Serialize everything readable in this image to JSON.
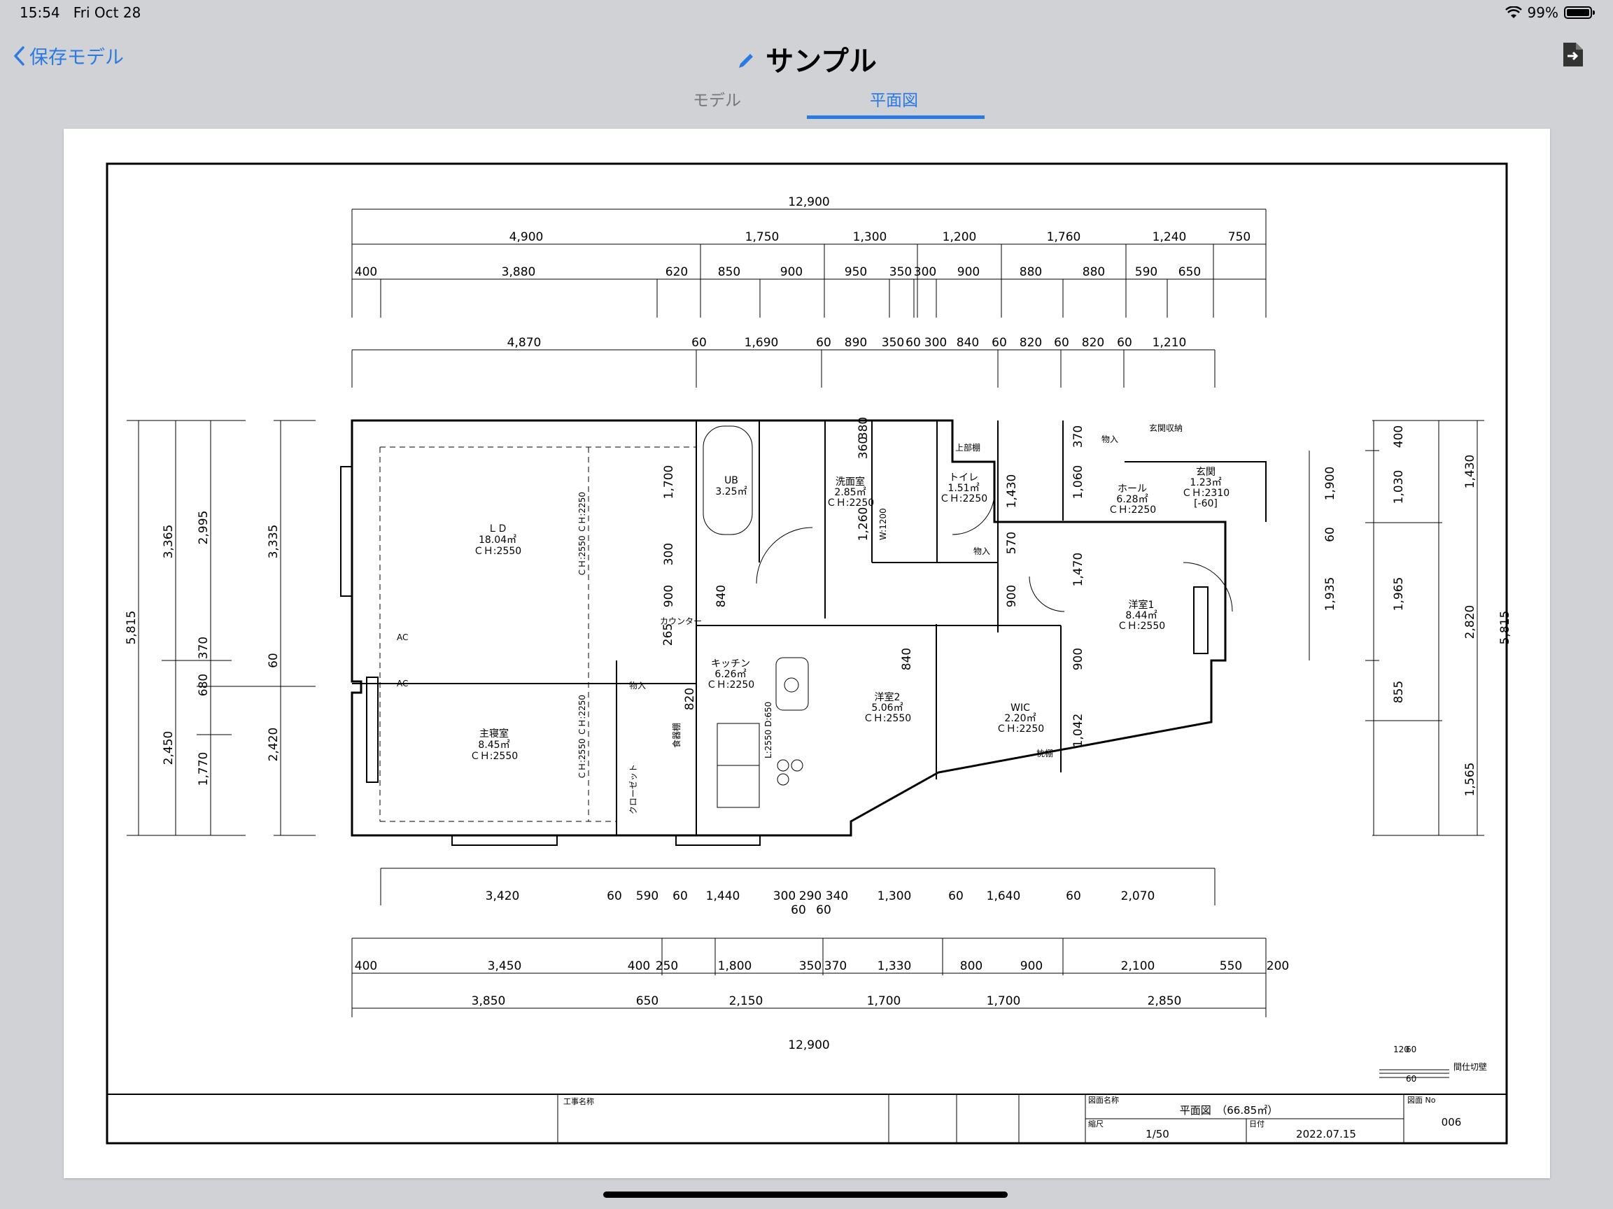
{
  "status": {
    "time": "15:54",
    "date": "Fri Oct 28",
    "battery": "99%"
  },
  "nav": {
    "back_label": "保存モデル",
    "title": "サンプル"
  },
  "tabs": [
    {
      "label": "モデル"
    },
    {
      "label": "平面図"
    }
  ],
  "dims": {
    "total": "12,900",
    "top1": [
      "4,900",
      "1,750",
      "1,300",
      "1,200",
      "1,760",
      "1,240",
      "750"
    ],
    "top2": [
      "400",
      "3,880",
      "620",
      "850",
      "900",
      "950",
      "350",
      "300",
      "900",
      "880",
      "880",
      "590",
      "650"
    ],
    "top3": [
      "4,870",
      "60",
      "1,690",
      "60",
      "890",
      "350",
      "60",
      "300",
      "840",
      "60",
      "820",
      "60",
      "820",
      "60",
      "1,210"
    ],
    "bot1": [
      "3,420",
      "60",
      "590",
      "60",
      "1,440",
      "300",
      "290",
      "340",
      "1,300",
      "60",
      "1,640",
      "60",
      "2,070"
    ],
    "bot1b": [
      "60",
      "60"
    ],
    "bot2": [
      "400",
      "3,450",
      "400",
      "250",
      "1,800",
      "350",
      "370",
      "1,330",
      "800",
      "900",
      "2,100",
      "550",
      "200"
    ],
    "bot3": [
      "3,850",
      "650",
      "2,150",
      "1,700",
      "1,700",
      "2,850"
    ],
    "left1": [
      "5,815"
    ],
    "left2": [
      "3,365",
      "2,450"
    ],
    "left3": [
      "2,995",
      "370",
      "680",
      "1,770"
    ],
    "left4": [
      "3,335",
      "60",
      "2,420"
    ],
    "right1": [
      "400",
      "1,030",
      "1,965",
      "855"
    ],
    "right2": [
      "1,430",
      "2,820",
      "1,565"
    ],
    "right3": [
      "5,815"
    ],
    "inner": [
      "1,700",
      "300",
      "900",
      "840",
      "1,260",
      "1,430",
      "570",
      "900",
      "1,060",
      "1,470",
      "900",
      "1,042",
      "840",
      "820",
      "1,900",
      "60",
      "1,935",
      "265",
      "360",
      "380",
      "370"
    ]
  },
  "rooms": {
    "ld": [
      "ＬＤ",
      "18.04㎡",
      "ＣＨ:2550"
    ],
    "master": [
      "主寝室",
      "8.45㎡",
      "ＣＨ:2550"
    ],
    "ub": [
      "UB",
      "3.25㎡"
    ],
    "wash": [
      "洗面室",
      "2.85㎡",
      "ＣＨ:2250"
    ],
    "toilet": [
      "トイレ",
      "1.51㎡",
      "ＣＨ:2250"
    ],
    "hall": [
      "ホール",
      "6.28㎡",
      "ＣＨ:2250"
    ],
    "entrance": [
      "玄関",
      "1.23㎡",
      "ＣＨ:2310",
      "[-60]"
    ],
    "kitchen": [
      "キッチン",
      "6.26㎡",
      "ＣＨ:2250"
    ],
    "room2": [
      "洋室2",
      "5.06㎡",
      "ＣＨ:2550"
    ],
    "room1": [
      "洋室1",
      "8.44㎡",
      "ＣＨ:2550"
    ],
    "wic": [
      "WIC",
      "2.20㎡",
      "ＣＨ:2250"
    ]
  },
  "labels": {
    "ch_ld": "ＣＨ:2550 ＣＨ:2250",
    "ch_mb": "ＣＨ:2550 ＣＨ:2250",
    "storage": "物入",
    "shelf": "棚",
    "upper_shelf": "上部棚",
    "genkan_storage": "玄関収納",
    "pillow_shelf": "枕棚",
    "closet": "クローゼット",
    "counter": "カウンター",
    "pantry": "食器棚",
    "ac": "AC",
    "w1200": "W:1200",
    "kitchen_l": "L:2550 D:650",
    "legend": "間仕切壁",
    "legend_nums": [
      "120",
      "60",
      "60"
    ]
  },
  "titleblock": {
    "project_label": "工事名称",
    "drawing_label": "図面名称",
    "drawing_name": "平面図　（66.85㎡）",
    "scale_label": "縮尺",
    "scale": "1/50",
    "date_label": "日付",
    "date": "2022.07.15",
    "no_label": "図面 No",
    "no": "006"
  }
}
